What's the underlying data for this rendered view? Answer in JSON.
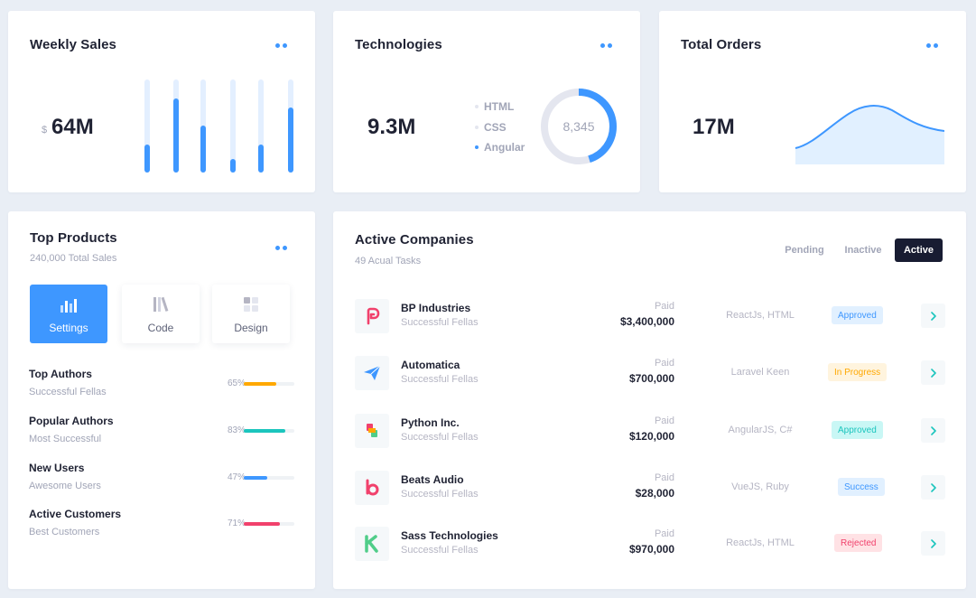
{
  "weekly_sales": {
    "title": "Weekly Sales",
    "currency": "$",
    "value": "64M",
    "bar_levels": [
      0.3,
      0.8,
      0.5,
      0.15,
      0.3,
      0.7
    ]
  },
  "technologies": {
    "title": "Technologies",
    "value": "9.3M",
    "legend": [
      {
        "label": "HTML",
        "active": false
      },
      {
        "label": "CSS",
        "active": false
      },
      {
        "label": "Angular",
        "active": true
      }
    ],
    "donut_center": "8,345",
    "donut_fraction": 0.45,
    "colors": {
      "accent": "#3e97ff",
      "track": "#e4e6ef"
    }
  },
  "total_orders": {
    "title": "Total Orders",
    "value": "17M"
  },
  "top_products": {
    "title": "Top Products",
    "subtitle": "240,000 Total Sales",
    "tiles": [
      {
        "label": "Settings",
        "icon": "bar-chart-icon",
        "active": true
      },
      {
        "label": "Code",
        "icon": "books-icon",
        "active": false
      },
      {
        "label": "Design",
        "icon": "grid-icon",
        "active": false
      }
    ],
    "stats": [
      {
        "name": "Top Authors",
        "desc": "Successful Fellas",
        "pct": "65%",
        "level": 0.65,
        "color": "#ffa800"
      },
      {
        "name": "Popular Authors",
        "desc": "Most Successful",
        "pct": "83%",
        "level": 0.83,
        "color": "#1bc5bd"
      },
      {
        "name": "New Users",
        "desc": "Awesome Users",
        "pct": "47%",
        "level": 0.47,
        "color": "#3e97ff"
      },
      {
        "name": "Active Customers",
        "desc": "Best Customers",
        "pct": "71%",
        "level": 0.71,
        "color": "#f1416c"
      }
    ]
  },
  "companies": {
    "title": "Active Companies",
    "subtitle": "49 Acual Tasks",
    "tabs": [
      "Pending",
      "Inactive",
      "Active"
    ],
    "active_tab": "Active",
    "rows": [
      {
        "name": "BP Industries",
        "desc": "Successful Fellas",
        "paid_label": "Paid",
        "amount": "$3,400,000",
        "tech": "ReactJs, HTML",
        "status": "Approved",
        "status_bg": "#e1f0ff",
        "status_fg": "#3e97ff",
        "logo": "bp-logo-icon"
      },
      {
        "name": "Automatica",
        "desc": "Successful Fellas",
        "paid_label": "Paid",
        "amount": "$700,000",
        "tech": "Laravel Keen",
        "status": "In Progress",
        "status_bg": "#fff4de",
        "status_fg": "#ffa800",
        "logo": "paper-plane-icon"
      },
      {
        "name": "Python Inc.",
        "desc": "Successful Fellas",
        "paid_label": "Paid",
        "amount": "$120,000",
        "tech": "AngularJS, C#",
        "status": "Approved",
        "status_bg": "#c9f7f5",
        "status_fg": "#1bc5bd",
        "logo": "python-logo-icon"
      },
      {
        "name": "Beats Audio",
        "desc": "Successful Fellas",
        "paid_label": "Paid",
        "amount": "$28,000",
        "tech": "VueJS, Ruby",
        "status": "Success",
        "status_bg": "#e1f0ff",
        "status_fg": "#3e97ff",
        "logo": "beats-logo-icon"
      },
      {
        "name": "Sass Technologies",
        "desc": "Successful Fellas",
        "paid_label": "Paid",
        "amount": "$970,000",
        "tech": "ReactJs, HTML",
        "status": "Rejected",
        "status_bg": "#ffe2e5",
        "status_fg": "#f1416c",
        "logo": "sass-logo-icon"
      }
    ]
  }
}
